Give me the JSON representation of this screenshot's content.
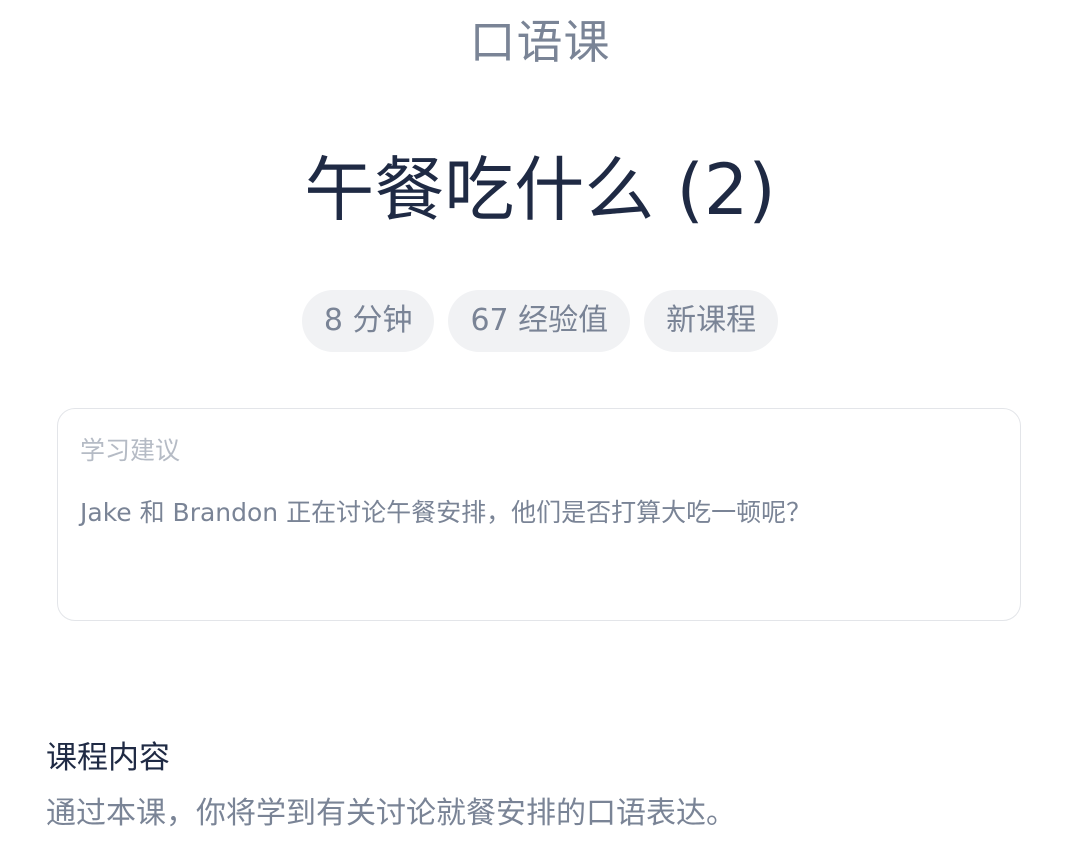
{
  "header": {
    "course_type": "口语课"
  },
  "lesson": {
    "title": "午餐吃什么 (2)",
    "tags": [
      "8 分钟",
      "67 经验值",
      "新课程"
    ]
  },
  "advice": {
    "label": "学习建议",
    "text": "Jake 和 Brandon 正在讨论午餐安排，他们是否打算大吃一顿呢？"
  },
  "course_content": {
    "title": "课程内容",
    "description": "通过本课，你将学到有关讨论就餐安排的口语表达。"
  }
}
